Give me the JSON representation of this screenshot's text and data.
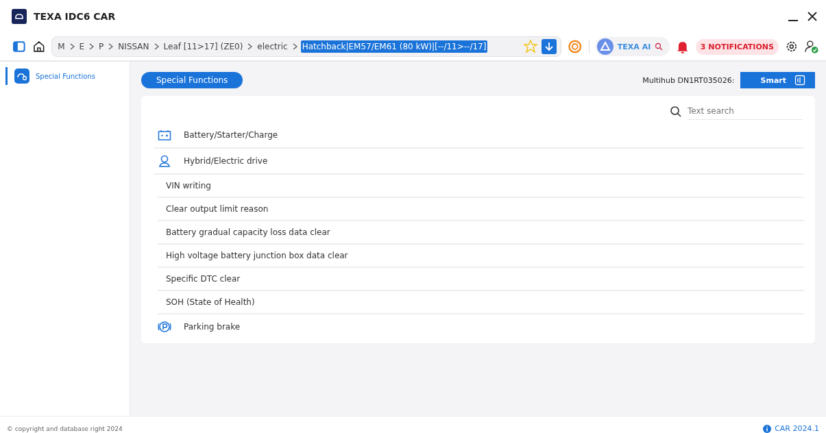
{
  "window": {
    "title": "TEXA IDC6 CAR"
  },
  "breadcrumb": [
    {
      "label": "M",
      "selected": false
    },
    {
      "label": "E",
      "selected": false
    },
    {
      "label": "P",
      "selected": false
    },
    {
      "label": "NISSAN",
      "selected": false
    },
    {
      "label": "Leaf [11>17] (ZE0)",
      "selected": false
    },
    {
      "label": "electric",
      "selected": false
    },
    {
      "label": "Hatchback|EM57/EM61 (80 kW)|[--/11>--/17]",
      "selected": true
    }
  ],
  "texa_ai": {
    "label": "TEXA AI"
  },
  "notifications": {
    "label": "3 NOTIFICATIONS"
  },
  "sidebar": {
    "items": [
      {
        "label": "Special Functions",
        "selected": true
      }
    ]
  },
  "header": {
    "title": "Special Functions",
    "device_label": "Multihub DN1RT035026:",
    "button": "Smart"
  },
  "search": {
    "placeholder": "Text search"
  },
  "functions": [
    {
      "kind": "battery",
      "label": "Battery/Starter/Charge"
    },
    {
      "kind": "drive",
      "label": "Hybrid/Electric drive"
    },
    {
      "kind": "function",
      "label": "VIN writing"
    },
    {
      "kind": "function",
      "label": "Clear output limit reason"
    },
    {
      "kind": "function",
      "label": "Battery gradual capacity loss data clear"
    },
    {
      "kind": "function",
      "label": "High voltage battery junction box data clear"
    },
    {
      "kind": "function",
      "label": "Specific DTC clear"
    },
    {
      "kind": "function",
      "label": "SOH (State of Health)"
    },
    {
      "kind": "parking",
      "label": "Parking brake"
    }
  ],
  "footer": {
    "copyright": "© copyright and database right 2024",
    "version": "CAR 2024.1"
  }
}
